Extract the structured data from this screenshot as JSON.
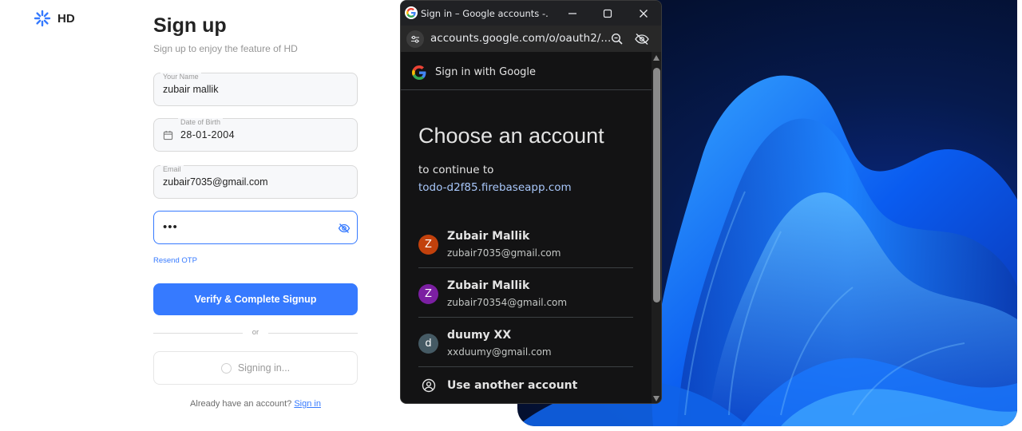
{
  "app": {
    "logo_text": "HD",
    "brand_color": "#367aff"
  },
  "signup": {
    "title": "Sign up",
    "subtitle": "Sign up to enjoy the feature of HD",
    "name_label": "Your Name",
    "name_value": "zubair mallik",
    "dob_label": "Date of Birth",
    "dob_value": "28-01-2004",
    "email_label": "Email",
    "email_value": "zubair7035@gmail.com",
    "otp_value": "•••",
    "resend_label": "Resend OTP",
    "submit_label": "Verify & Complete Signup",
    "divider_text": "or",
    "google_status": "Signing in...",
    "footer_text": "Already have an account?",
    "signin_link": "Sign in"
  },
  "popup": {
    "window_title": "Sign in – Google accounts -...",
    "url": "accounts.google.com/o/oauth2/...",
    "header": "Sign in with Google",
    "heading": "Choose an account",
    "continue_text": "to continue to",
    "domain": "todo-d2f85.firebaseapp.com",
    "accounts": [
      {
        "initial": "Z",
        "name": "Zubair Mallik",
        "email": "zubair7035@gmail.com",
        "color": "#c2410c"
      },
      {
        "initial": "Z",
        "name": "Zubair Mallik",
        "email": "zubair70354@gmail.com",
        "color": "#7b1fa2"
      },
      {
        "initial": "d",
        "name": "duumy XX",
        "email": "xxduumy@gmail.com",
        "color": "#455a64"
      }
    ],
    "another_account": "Use another account"
  }
}
